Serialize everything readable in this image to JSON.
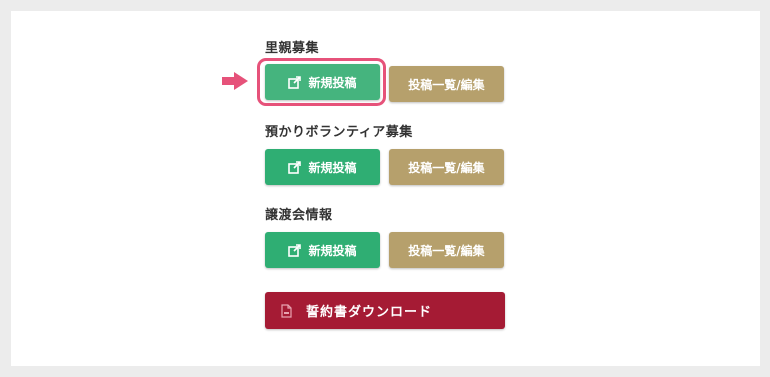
{
  "sections": [
    {
      "heading": "里親募集",
      "new_post_label": "新規投稿",
      "list_edit_label": "投稿一覧/編集"
    },
    {
      "heading": "預かりボランティア募集",
      "new_post_label": "新規投稿",
      "list_edit_label": "投稿一覧/編集"
    },
    {
      "heading": "譲渡会情報",
      "new_post_label": "新規投稿",
      "list_edit_label": "投稿一覧/編集"
    }
  ],
  "pledge_download_label": "誓約書ダウンロード",
  "icons": {
    "new_post": "edit-external-icon",
    "pledge": "pdf-file-icon",
    "pointer": "pointer-arrow-icon"
  },
  "colors": {
    "new_post_button": "#2fae73",
    "list_edit_button": "#b6a06c",
    "pledge_button": "#a51b34",
    "highlight": "#e6527a"
  }
}
